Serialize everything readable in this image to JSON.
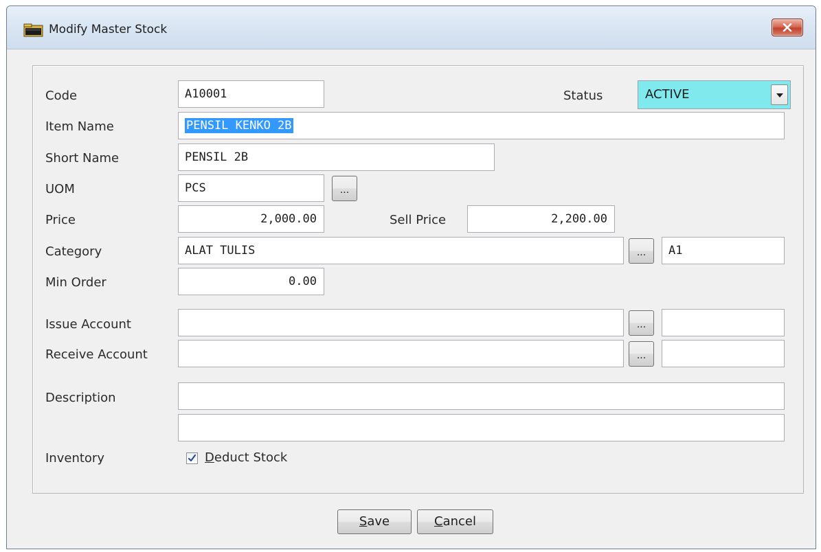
{
  "window": {
    "title": "Modify Master Stock",
    "icon": "folder-icon",
    "close_icon": "close-icon"
  },
  "form": {
    "code_label": "Code",
    "code_value": "A10001",
    "status_label": "Status",
    "status_value": "ACTIVE",
    "item_name_label": "Item Name",
    "item_name_value": "PENSIL KENKO 2B",
    "short_name_label": "Short Name",
    "short_name_value": "PENSIL 2B",
    "uom_label": "UOM",
    "uom_value": "PCS",
    "price_label": "Price",
    "price_value": "2,000.00",
    "sell_price_label": "Sell Price",
    "sell_price_value": "2,200.00",
    "category_label": "Category",
    "category_value": "ALAT TULIS",
    "category_code_value": "A1",
    "min_order_label": "Min Order",
    "min_order_value": "0.00",
    "issue_account_label": "Issue Account",
    "issue_account_value": "",
    "issue_account_code": "",
    "receive_account_label": "Receive Account",
    "receive_account_value": "",
    "receive_account_code": "",
    "description_label": "Description",
    "description_line1": "",
    "description_line2": "",
    "inventory_label": "Inventory",
    "deduct_stock_accel": "D",
    "deduct_stock_rest": "educt Stock",
    "deduct_stock_checked": true,
    "browse_label": "..."
  },
  "buttons": {
    "save_accel": "S",
    "save_rest": "ave",
    "cancel_accel": "C",
    "cancel_rest": "ancel"
  },
  "colors": {
    "status_bg": "#7fe9ee",
    "selection": "#3399ff",
    "close_button": "#c2422c"
  }
}
